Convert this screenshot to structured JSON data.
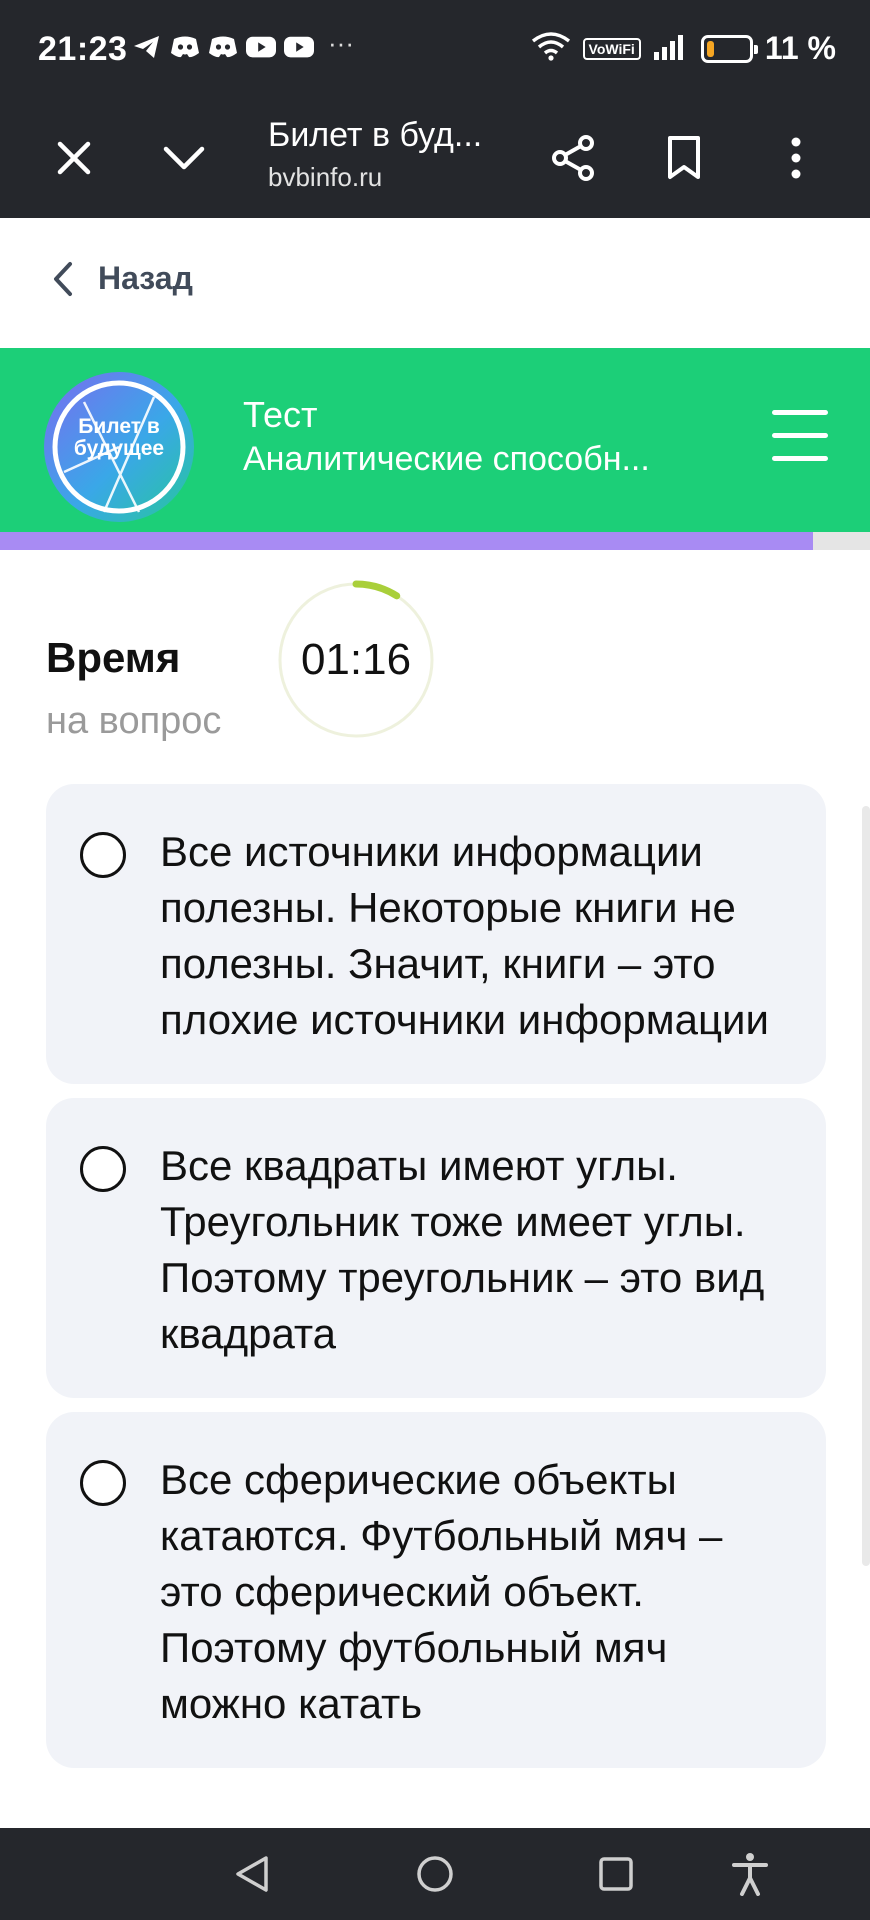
{
  "status_bar": {
    "time": "21:23",
    "more_indicator": "···",
    "vowifi": "VoWiFi",
    "battery_percent": "11 %",
    "battery_level": 0.11,
    "notification_icons": [
      "telegram-icon",
      "discord-icon",
      "discord-icon",
      "youtube-icon",
      "youtube-icon"
    ]
  },
  "browser": {
    "page_title": "Билет в буд...",
    "url": "bvbinfo.ru"
  },
  "nav": {
    "back_label": "Назад"
  },
  "header": {
    "logo_text": "Билет в будущее",
    "title_line1": "Тест",
    "title_line2": "Аналитические способн...",
    "accent_color": "#1ccf78"
  },
  "progress": {
    "fraction": 0.935,
    "color": "#a88bf3"
  },
  "timer": {
    "label": "Время",
    "sublabel": "на вопрос",
    "value": "01:16",
    "fraction_elapsed": 0.09,
    "arc_color": "#a9cf3a"
  },
  "options": [
    {
      "text": "Все источники информации полезны. Некоторые книги не полезны. Значит, книги – это плохие источники информации",
      "selected": false
    },
    {
      "text": "Все квадраты имеют углы. Треугольник тоже имеет углы. Поэтому треугольник – это вид квадрата",
      "selected": false
    },
    {
      "text": "Все сферические объекты катаются. Футбольный мяч – это сферический объект. Поэтому футбольный мяч можно катать",
      "selected": false
    }
  ]
}
